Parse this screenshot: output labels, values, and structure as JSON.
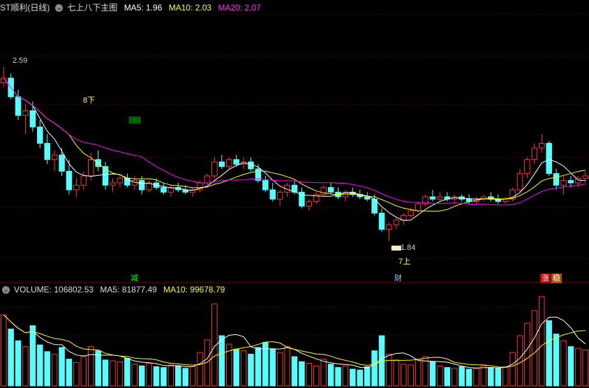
{
  "header": {
    "stock_name": "ST顺利(日线)",
    "indicator_title": "七上八下主图",
    "ma5_label": "MA5: 1.96",
    "ma10_label": "MA10: 2.03",
    "ma20_label": "MA20: 2.07"
  },
  "volume_header": {
    "volume_label": "VOLUME: 106802.53",
    "ma5_label": "MA5: 81877.49",
    "ma10_label": "MA10: 99678.79"
  },
  "annotations": {
    "high_price": "2.59",
    "low_price": "1.84",
    "signal_down": "8下",
    "signal_up": "7上",
    "marker_jian": "减",
    "marker_cai": "财",
    "marker_zhang": "涨",
    "marker_wen": "稳"
  },
  "colors": {
    "background": "#000000",
    "up": "#ff3232",
    "down": "#54ffff",
    "ma5": "#ffffff",
    "ma10": "#ffff00",
    "ma20": "#ff00ff",
    "signal_box": "#006400",
    "grid": "#800000"
  },
  "chart_data": {
    "type": "candlestick",
    "price_range": [
      1.76,
      2.66
    ],
    "grid": true,
    "candles": [
      [
        2.52,
        2.59,
        2.5,
        2.54
      ],
      [
        2.54,
        2.56,
        2.45,
        2.46
      ],
      [
        2.46,
        2.49,
        2.36,
        2.38
      ],
      [
        2.38,
        2.43,
        2.3,
        2.4
      ],
      [
        2.4,
        2.44,
        2.31,
        2.33
      ],
      [
        2.33,
        2.36,
        2.24,
        2.26
      ],
      [
        2.26,
        2.3,
        2.17,
        2.19
      ],
      [
        2.19,
        2.23,
        2.14,
        2.21
      ],
      [
        2.21,
        2.24,
        2.12,
        2.14
      ],
      [
        2.14,
        2.19,
        2.04,
        2.06
      ],
      [
        2.06,
        2.11,
        2.03,
        2.08
      ],
      [
        2.08,
        2.14,
        2.06,
        2.12
      ],
      [
        2.12,
        2.22,
        2.1,
        2.19
      ],
      [
        2.19,
        2.23,
        2.14,
        2.16
      ],
      [
        2.16,
        2.18,
        2.06,
        2.08
      ],
      [
        2.08,
        2.11,
        2.05,
        2.09
      ],
      [
        2.09,
        2.12,
        2.07,
        2.11
      ],
      [
        2.11,
        2.13,
        2.07,
        2.08
      ],
      [
        2.08,
        2.12,
        2.06,
        2.1
      ],
      [
        2.1,
        2.12,
        2.04,
        2.06
      ],
      [
        2.06,
        2.1,
        2.05,
        2.09
      ],
      [
        2.09,
        2.11,
        2.06,
        2.07
      ],
      [
        2.07,
        2.09,
        2.04,
        2.05
      ],
      [
        2.05,
        2.08,
        2.03,
        2.07
      ],
      [
        2.07,
        2.09,
        2.05,
        2.06
      ],
      [
        2.06,
        2.08,
        2.04,
        2.05
      ],
      [
        2.05,
        2.07,
        2.03,
        2.06
      ],
      [
        2.06,
        2.1,
        2.05,
        2.09
      ],
      [
        2.09,
        2.13,
        2.08,
        2.12
      ],
      [
        2.12,
        2.2,
        2.11,
        2.18
      ],
      [
        2.18,
        2.21,
        2.15,
        2.16
      ],
      [
        2.16,
        2.2,
        2.15,
        2.19
      ],
      [
        2.19,
        2.21,
        2.16,
        2.17
      ],
      [
        2.17,
        2.2,
        2.15,
        2.18
      ],
      [
        2.18,
        2.2,
        2.14,
        2.15
      ],
      [
        2.15,
        2.17,
        2.09,
        2.1
      ],
      [
        2.1,
        2.12,
        2.05,
        2.06
      ],
      [
        2.06,
        2.09,
        2.01,
        2.02
      ],
      [
        2.02,
        2.06,
        1.99,
        2.05
      ],
      [
        2.05,
        2.09,
        2.03,
        2.08
      ],
      [
        2.08,
        2.1,
        2.04,
        2.05
      ],
      [
        2.05,
        2.07,
        1.98,
        1.99
      ],
      [
        1.99,
        2.02,
        1.97,
        2.01
      ],
      [
        2.01,
        2.05,
        2.0,
        2.04
      ],
      [
        2.04,
        2.08,
        2.03,
        2.07
      ],
      [
        2.07,
        2.09,
        2.04,
        2.05
      ],
      [
        2.05,
        2.07,
        2.02,
        2.03
      ],
      [
        2.03,
        2.06,
        2.01,
        2.05
      ],
      [
        2.05,
        2.07,
        2.03,
        2.04
      ],
      [
        2.04,
        2.06,
        2.02,
        2.03
      ],
      [
        2.03,
        2.05,
        2.01,
        2.02
      ],
      [
        2.02,
        2.04,
        1.95,
        1.96
      ],
      [
        1.96,
        1.98,
        1.88,
        1.89
      ],
      [
        1.89,
        1.92,
        1.84,
        1.91
      ],
      [
        1.91,
        1.94,
        1.89,
        1.93
      ],
      [
        1.93,
        1.96,
        1.91,
        1.95
      ],
      [
        1.95,
        1.98,
        1.94,
        1.97
      ],
      [
        1.97,
        2.01,
        1.96,
        2.0
      ],
      [
        2.0,
        2.04,
        1.99,
        2.03
      ],
      [
        2.03,
        2.06,
        2.01,
        2.02
      ],
      [
        2.02,
        2.05,
        2.01,
        2.03
      ],
      [
        2.03,
        2.05,
        2.01,
        2.02
      ],
      [
        2.02,
        2.04,
        2.0,
        2.03
      ],
      [
        2.03,
        2.04,
        2.01,
        2.02
      ],
      [
        2.02,
        2.04,
        2.0,
        2.01
      ],
      [
        2.01,
        2.03,
        2.0,
        2.02
      ],
      [
        2.02,
        2.04,
        2.01,
        2.03
      ],
      [
        2.03,
        2.05,
        2.01,
        2.02
      ],
      [
        2.02,
        2.04,
        2.0,
        2.01
      ],
      [
        2.01,
        2.03,
        2.0,
        2.02
      ],
      [
        2.02,
        2.07,
        2.01,
        2.06
      ],
      [
        2.06,
        2.15,
        2.05,
        2.13
      ],
      [
        2.13,
        2.2,
        2.11,
        2.19
      ],
      [
        2.19,
        2.26,
        2.17,
        2.24
      ],
      [
        2.24,
        2.3,
        2.22,
        2.26
      ],
      [
        2.26,
        2.27,
        2.12,
        2.13
      ],
      [
        2.13,
        2.15,
        2.06,
        2.08
      ],
      [
        2.08,
        2.12,
        2.04,
        2.1
      ],
      [
        2.1,
        2.12,
        2.07,
        2.09
      ],
      [
        2.09,
        2.12,
        2.07,
        2.11
      ],
      [
        2.11,
        2.14,
        2.09,
        2.12
      ]
    ],
    "volumes": [
      85000,
      68000,
      54000,
      47000,
      72000,
      49000,
      41000,
      38000,
      46000,
      32000,
      28000,
      35000,
      47000,
      42000,
      31000,
      30000,
      29000,
      33000,
      26000,
      24000,
      27000,
      23000,
      22000,
      25000,
      24000,
      21000,
      23000,
      40000,
      55000,
      98000,
      60000,
      50000,
      44000,
      42000,
      38000,
      46000,
      52000,
      44000,
      40000,
      47000,
      35000,
      29000,
      27000,
      24000,
      32000,
      26000,
      22000,
      24000,
      20000,
      19000,
      23000,
      42000,
      60000,
      38000,
      31000,
      26000,
      25000,
      32000,
      35000,
      29000,
      24000,
      22000,
      21000,
      23000,
      20000,
      21000,
      24000,
      22000,
      21000,
      23000,
      40000,
      60000,
      75000,
      90000,
      106802,
      78000,
      62000,
      54000,
      47000,
      45000,
      43000
    ],
    "signals": [
      {
        "label": "8下",
        "index": 18
      },
      {
        "label": "7上",
        "index": 54
      }
    ]
  }
}
